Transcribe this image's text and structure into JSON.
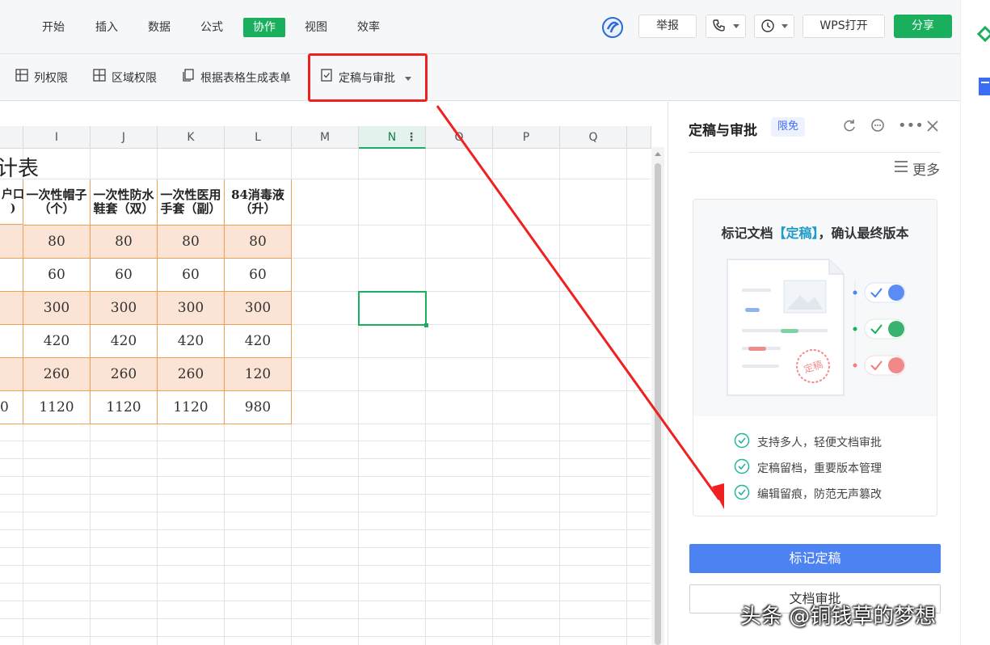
{
  "menu": {
    "items": [
      "开始",
      "插入",
      "数据",
      "公式",
      "协作",
      "视图",
      "效率"
    ],
    "active": "协作",
    "report": "举报",
    "wps_open": "WPS打开",
    "share": "分享"
  },
  "toolbar": {
    "col_permission": "列权限",
    "range_permission": "区域权限",
    "generate_form": "根据表格生成表单",
    "finalize_review": "定稿与审批"
  },
  "sheet": {
    "columns": [
      "I",
      "J",
      "K",
      "L",
      "M",
      "N",
      "O",
      "P",
      "Q"
    ],
    "selected_column": "N",
    "title_fragment": "计表",
    "partial_header": "户口\n)",
    "headers": [
      "一次性帽子（个）",
      "一次性防水鞋套（双）",
      "一次性医用手套（副）",
      "84消毒液（升）"
    ],
    "rows": [
      [
        "80",
        "80",
        "80",
        "80"
      ],
      [
        "60",
        "60",
        "60",
        "60"
      ],
      [
        "300",
        "300",
        "300",
        "300"
      ],
      [
        "420",
        "420",
        "420",
        "420"
      ],
      [
        "260",
        "260",
        "260",
        "120"
      ],
      [
        "1120",
        "1120",
        "1120",
        "980"
      ]
    ],
    "partial_total": "0"
  },
  "panel": {
    "title": "定稿与审批",
    "badge": "限免",
    "more": "更多",
    "card_heading_pre": "标记文档",
    "card_heading_tag": "【定稿】",
    "card_heading_post": "，确认最终版本",
    "stamp": "定稿",
    "features": [
      "支持多人，轻便文档审批",
      "定稿留档，重要版本管理",
      "编辑留痕，防范无声篡改"
    ],
    "mark_button": "标记定稿",
    "review_button": "文档审批"
  },
  "watermark": "头条 @铜钱草的梦想",
  "colors": {
    "accent_green": "#1aaf5d",
    "primary_blue": "#4d82f3",
    "highlight_red": "#f02020"
  }
}
